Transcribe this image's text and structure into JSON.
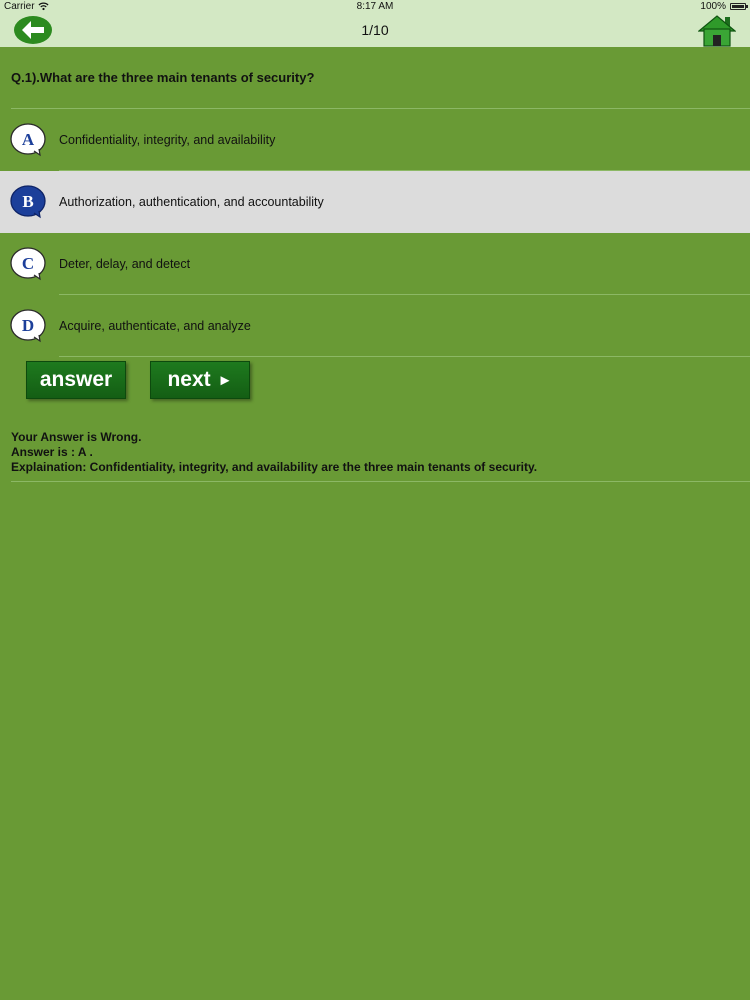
{
  "status_bar": {
    "carrier": "Carrier",
    "time": "8:17 AM",
    "battery": "100%"
  },
  "nav": {
    "title": "1/10",
    "back_icon": "back-arrow-icon",
    "home_icon": "home-icon"
  },
  "question": {
    "text": "Q.1).What are the three main tenants of security?"
  },
  "options": [
    {
      "letter": "A",
      "text": "Confidentiality, integrity, and availability",
      "selected": false
    },
    {
      "letter": "B",
      "text": "Authorization, authentication, and accountability",
      "selected": true
    },
    {
      "letter": "C",
      "text": "Deter, delay, and detect",
      "selected": false
    },
    {
      "letter": "D",
      "text": "Acquire, authenticate, and analyze",
      "selected": false
    }
  ],
  "actions": {
    "answer_label": "answer",
    "next_label": "next",
    "next_icon": "►"
  },
  "result": {
    "status": "Your Answer is Wrong.",
    "answer": "Answer is : A .",
    "explanation": "Explaination: Confidentiality, integrity, and availability are the three main tenants of security."
  },
  "colors": {
    "background": "#699a35",
    "bar": "#d3e8c4",
    "selected_row": "#dcdcdc",
    "button": "#1a6e1a",
    "badge_selected": "#1c3f9a"
  }
}
